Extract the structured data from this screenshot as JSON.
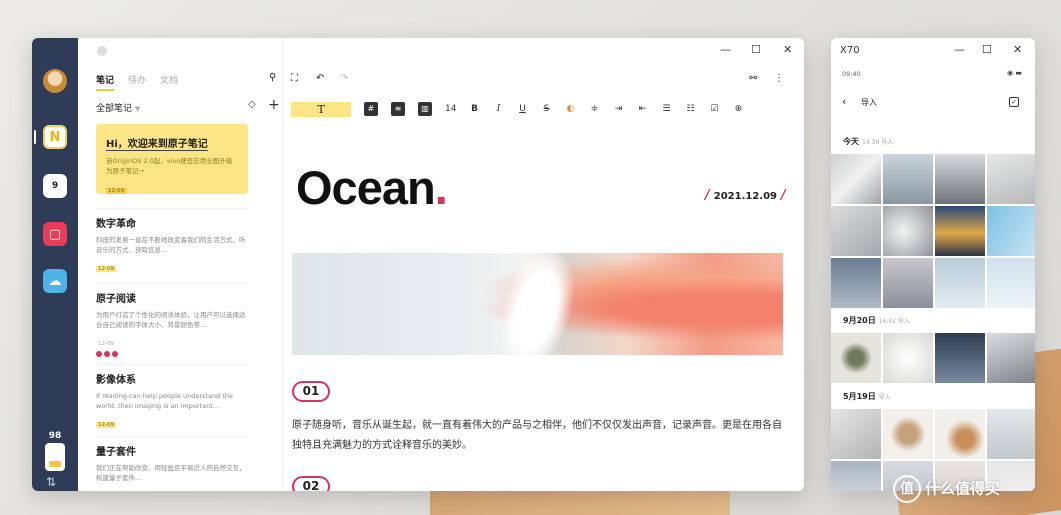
{
  "main_window": {
    "list_tabs": [
      "笔记",
      "待办",
      "文档"
    ],
    "filter_label": "全部笔记",
    "featured_note": {
      "title": "Hi，欢迎来到原子笔记",
      "body": "自OriginOS 2.0起，vivo便签应用全面升级为原子笔记→",
      "date": "12-09"
    },
    "notes": [
      {
        "title": "数字革命",
        "body": "科技的发展一直在不断地改变着我们的生活方式，听音乐的方式、获取信息…",
        "date": "12-09"
      },
      {
        "title": "原子阅读",
        "body": "为用户打造了个性化的阅读体验，让用户可以选择适合自己阅读的字体大小、背景颜色等…",
        "date": "12-09"
      },
      {
        "title": "影像体系",
        "body": "If reading can help people understand the world, then imaging is an important…",
        "date": "12-09"
      },
      {
        "title": "量子套件",
        "body": "我们正在帮助改变、用轻盈且平易近人的自然交互，构建量子套件…",
        "date": "12-09"
      }
    ],
    "dock": {
      "battery_text": "98",
      "calendar_day": "9"
    },
    "editor": {
      "format_font_label": "T",
      "font_size": "14",
      "title": "Ocean",
      "title_dot": ".",
      "date": "2021.12.09",
      "section1": "01",
      "section2": "02",
      "paragraph": "原子随身听，音乐从诞生起，就一直有着伟大的产品与之相伴，他们不仅仅发出声音，记录声音。更是在用各自独特且充满魅力的方式诠释音乐的美妙。"
    }
  },
  "side_window": {
    "title": "X70",
    "time": "09:40",
    "header": "导入",
    "groups": [
      {
        "label": "今天",
        "meta": "14:30  导入"
      },
      {
        "label": "9月20日",
        "meta": "16:42  导入"
      },
      {
        "label": "5月19日",
        "meta": "导入"
      }
    ]
  },
  "watermark": "什么值得买",
  "watermark_logo": "值",
  "colors": {
    "accent_red": "#d7325d",
    "highlight_yellow": "#fbe585",
    "dock": "#2f3c57"
  }
}
